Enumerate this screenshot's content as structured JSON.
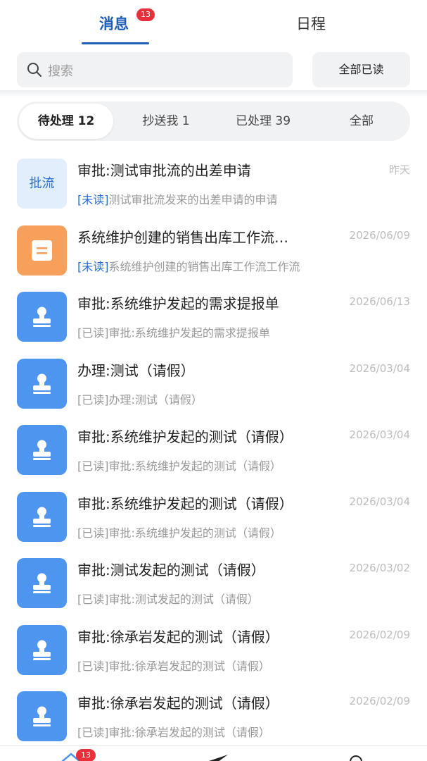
{
  "top_tabs": {
    "messages_label": "消息",
    "messages_badge": "13",
    "schedule_label": "日程"
  },
  "search": {
    "placeholder": "搜索"
  },
  "read_all_label": "全部已读",
  "filters": [
    {
      "label": "待处理 12"
    },
    {
      "label": "抄送我 1"
    },
    {
      "label": "已处理 39"
    },
    {
      "label": "全部"
    }
  ],
  "messages": [
    {
      "icon": "text-badge",
      "icon_text": "批流",
      "title": "审批:测试审批流的出差申请",
      "date": "昨天",
      "status": "[未读]",
      "preview": "测试审批流发来的出差申请的申请"
    },
    {
      "icon": "document-icon",
      "title": "系统维护创建的销售出库工作流…",
      "date": "2026/06/09",
      "status": "[未读]",
      "preview": "系统维护创建的销售出库工作流工作流"
    },
    {
      "icon": "stamp-icon",
      "title": "审批:系统维护发起的需求提报单",
      "date": "2026/06/13",
      "status": "[已读]",
      "preview": "审批:系统维护发起的需求提报单"
    },
    {
      "icon": "stamp-icon",
      "title": "办理:测试（请假）",
      "date": "2026/03/04",
      "status": "[已读]",
      "preview": "办理:测试（请假）"
    },
    {
      "icon": "stamp-icon",
      "title": "审批:系统维护发起的测试（请假）",
      "date": "2026/03/04",
      "status": "[已读]",
      "preview": "审批:系统维护发起的测试（请假）"
    },
    {
      "icon": "stamp-icon",
      "title": "审批:系统维护发起的测试（请假）",
      "date": "2026/03/04",
      "status": "[已读]",
      "preview": "审批:系统维护发起的测试（请假）"
    },
    {
      "icon": "stamp-icon",
      "title": "审批:测试发起的测试（请假）",
      "date": "2026/03/02",
      "status": "[已读]",
      "preview": "审批:测试发起的测试（请假）"
    },
    {
      "icon": "stamp-icon",
      "title": "审批:徐承岩发起的测试（请假）",
      "date": "2026/02/09",
      "status": "[已读]",
      "preview": "审批:徐承岩发起的测试（请假）"
    },
    {
      "icon": "stamp-icon",
      "title": "审批:徐承岩发起的测试（请假）",
      "date": "2026/02/09",
      "status": "[已读]",
      "preview": "审批:徐承岩发起的测试（请假）"
    }
  ],
  "bottom_nav": {
    "badge": "13"
  },
  "colors": {
    "accent": "#1f5fb8",
    "badge": "#e8303a",
    "icon_blue": "#4d95ee",
    "icon_orange": "#f7a05c",
    "unread_tag": "#2a6fcf"
  }
}
